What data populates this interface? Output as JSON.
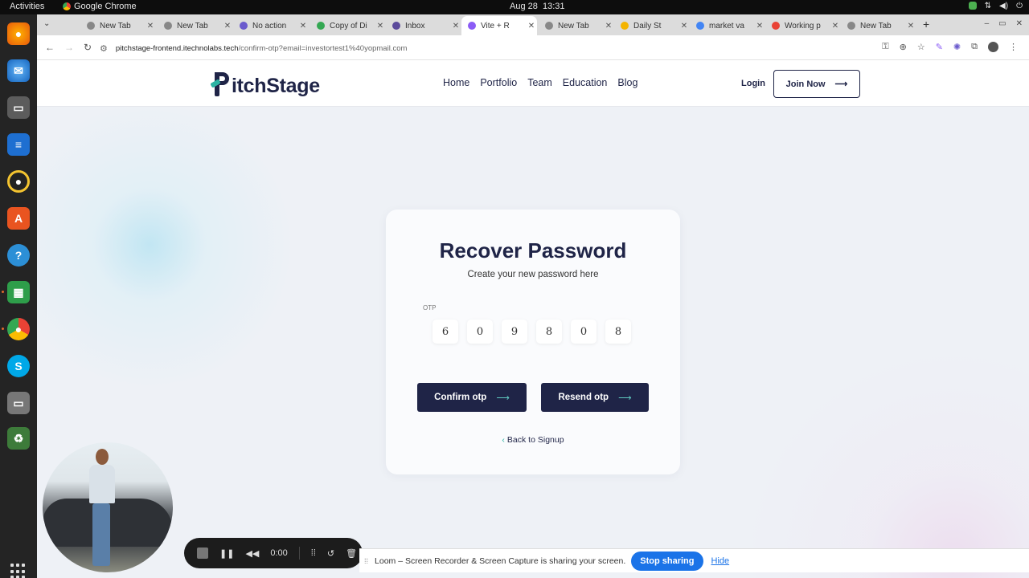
{
  "system": {
    "activities": "Activities",
    "app_name": "Google Chrome",
    "date": "Aug 28",
    "time": "13:31"
  },
  "tabs": [
    {
      "title": "New Tab",
      "favicon_color": "#888888",
      "active": false
    },
    {
      "title": "New Tab",
      "favicon_color": "#888888",
      "active": false
    },
    {
      "title": "No action",
      "favicon_color": "#6a5acd",
      "active": false
    },
    {
      "title": "Copy of Di",
      "favicon_color": "#34a853",
      "active": false
    },
    {
      "title": "Inbox",
      "favicon_color": "#5b4a9b",
      "active": false
    },
    {
      "title": "Vite + R",
      "favicon_color": "#8b5cf6",
      "active": true
    },
    {
      "title": "New Tab",
      "favicon_color": "#888888",
      "active": false
    },
    {
      "title": "Daily St",
      "favicon_color": "#f4b400",
      "active": false
    },
    {
      "title": "market va",
      "favicon_color": "#4285f4",
      "active": false
    },
    {
      "title": "Working p",
      "favicon_color": "#e94235",
      "active": false
    },
    {
      "title": "New Tab",
      "favicon_color": "#888888",
      "active": false
    }
  ],
  "address": {
    "host": "pitchstage-frontend.itechnolabs.tech",
    "path": "/confirm-otp?email=investortest1%40yopmail.com"
  },
  "site": {
    "logo_text": "itchStage",
    "nav": [
      "Home",
      "Portfolio",
      "Team",
      "Education",
      "Blog"
    ],
    "login": "Login",
    "join": "Join Now",
    "join_arrow": "⟶"
  },
  "card": {
    "title": "Recover Password",
    "subtitle": "Create your new password here",
    "otp_label": "OTP",
    "otp_digits": [
      "6",
      "0",
      "9",
      "8",
      "0",
      "8"
    ],
    "confirm_label": "Confirm otp",
    "resend_label": "Resend otp",
    "button_arrow": "⟶",
    "back_label": "Back to Signup"
  },
  "loom": {
    "timer": "0:00",
    "message": "Loom – Screen Recorder & Screen Capture is sharing your screen.",
    "stop_sharing": "Stop sharing",
    "hide": "Hide"
  },
  "colors": {
    "brand_navy": "#1f2447",
    "brand_teal": "#2bb3a3",
    "loom_blue": "#1a73e8"
  }
}
